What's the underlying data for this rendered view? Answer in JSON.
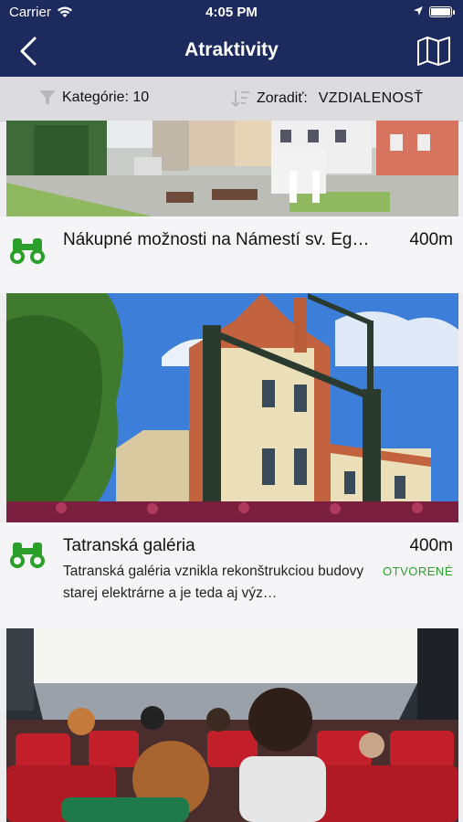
{
  "status_bar": {
    "carrier": "Carrier",
    "time": "4:05 PM"
  },
  "nav": {
    "title": "Atraktivity"
  },
  "filters": {
    "category_label": "Kategórie: 10",
    "sort_label": "Zoradiť:",
    "sort_value": "VZDIALENOSŤ"
  },
  "items": [
    {
      "title": "Nákupné možnosti na Námestí sv. Egídia",
      "distance": "400m"
    },
    {
      "title": "Tatranská galéria",
      "distance": "400m",
      "description": "Tatranská galéria vznikla rekonštrukciou budovy starej elektrárne a je teda aj výz…",
      "status": "OTVORENÉ"
    }
  ],
  "colors": {
    "nav_bg": "#1c2a5e",
    "accent_green": "#2aa02a",
    "open_status": "#2aa02a"
  }
}
